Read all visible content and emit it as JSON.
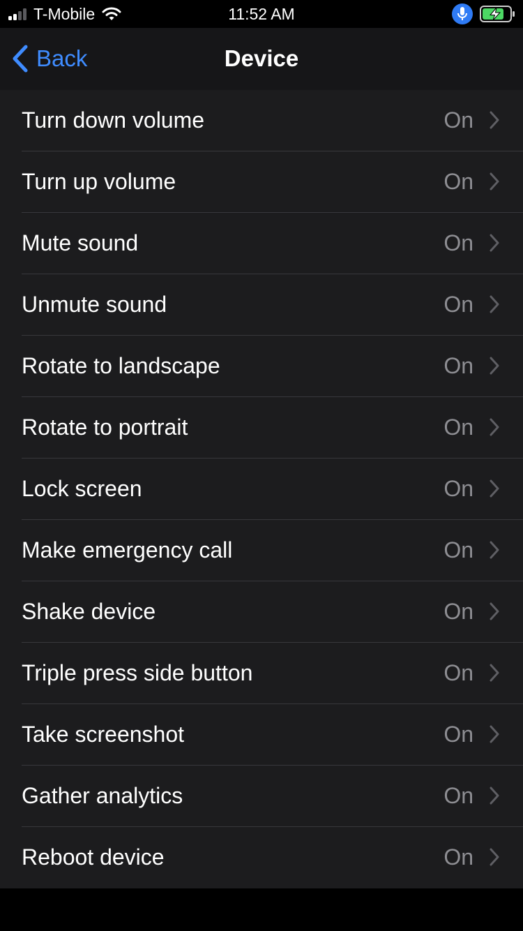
{
  "status_bar": {
    "carrier": "T-Mobile",
    "time": "11:52 AM",
    "signal_bars": 4,
    "signal_bars_active": 2,
    "icons": [
      "signal-icon",
      "wifi-icon",
      "microphone-icon",
      "battery-charging-icon"
    ]
  },
  "nav": {
    "back_label": "Back",
    "title": "Device"
  },
  "items": [
    {
      "label": "Turn down volume",
      "value": "On"
    },
    {
      "label": "Turn up volume",
      "value": "On"
    },
    {
      "label": "Mute sound",
      "value": "On"
    },
    {
      "label": "Unmute sound",
      "value": "On"
    },
    {
      "label": "Rotate to landscape",
      "value": "On"
    },
    {
      "label": "Rotate to portrait",
      "value": "On"
    },
    {
      "label": "Lock screen",
      "value": "On"
    },
    {
      "label": "Make emergency call",
      "value": "On"
    },
    {
      "label": "Shake device",
      "value": "On"
    },
    {
      "label": "Triple press side button",
      "value": "On"
    },
    {
      "label": "Take screenshot",
      "value": "On"
    },
    {
      "label": "Gather analytics",
      "value": "On"
    },
    {
      "label": "Reboot device",
      "value": "On"
    }
  ],
  "colors": {
    "background": "#000000",
    "nav_background": "#161618",
    "row_background": "#1c1c1e",
    "separator": "#38383c",
    "accent": "#3f8cff",
    "secondary_text": "#8e8e93",
    "battery_green": "#4cd964",
    "mic_blue": "#2f7bf5"
  }
}
